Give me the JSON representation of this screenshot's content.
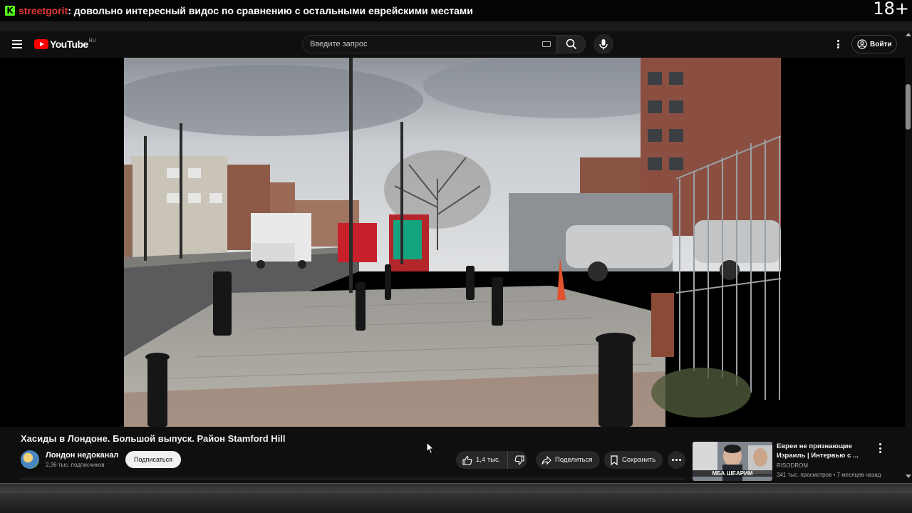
{
  "overlay": {
    "streamer": "streetgorit",
    "message": ": довольно интересный видос по сравнению с остальными еврейскими местами",
    "age_rating": "18+",
    "brand_color": "#53fc18"
  },
  "header": {
    "logo_text": "YouTube",
    "logo_region": "RU",
    "search_placeholder": "Введите запрос",
    "signin_label": "Войти",
    "icons": [
      "menu-icon",
      "keyboard-icon",
      "search-icon",
      "mic-icon",
      "more-vert-icon",
      "account-icon"
    ]
  },
  "video": {
    "title": "Хасиды в Лондоне. Большой выпуск. Район Stamford Hill"
  },
  "channel": {
    "name": "Лондон недоканал",
    "subscribers": "2,36 тыс. подписчиков",
    "subscribe_label": "Подписаться"
  },
  "actions": {
    "likes": "1,4 тыс.",
    "share_label": "Поделиться",
    "save_label": "Сохранить"
  },
  "recommendation": {
    "title": "Евреи не признающие Израиль | Интервью с ...",
    "channel": "RISODROM",
    "meta": "341 тыс. просмотров • 7 месяцев назад",
    "thumb_caption": "МБА ШЕАРИМ"
  }
}
